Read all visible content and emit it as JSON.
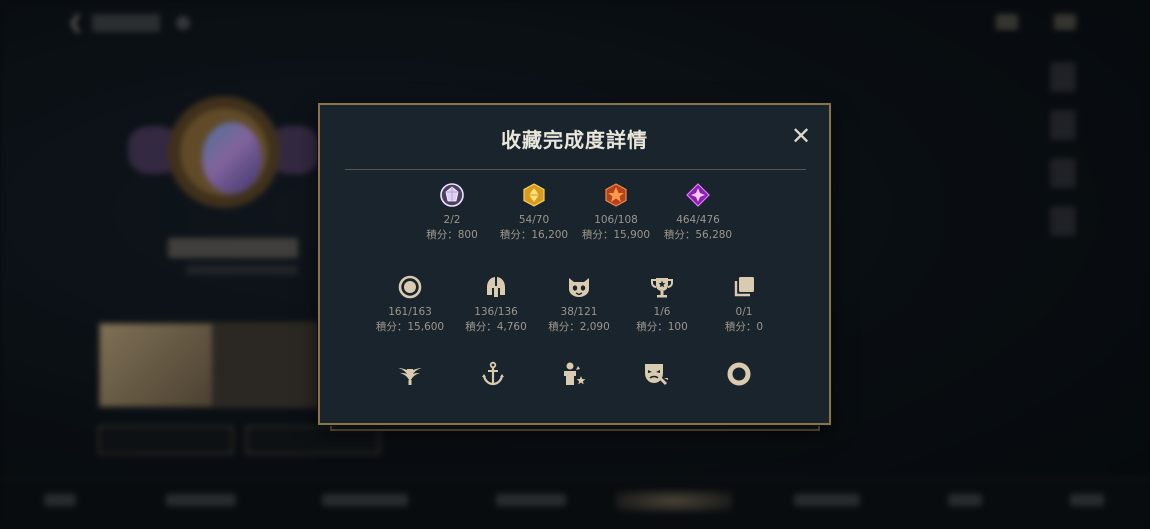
{
  "modal": {
    "title": "收藏完成度詳情",
    "close_label": "✕",
    "points_label": "積分："
  },
  "row1": [
    {
      "icon": "white-gem-icon",
      "count": "2/2",
      "points": "800",
      "color": "#d9c8f4"
    },
    {
      "icon": "gold-gem-icon",
      "count": "54/70",
      "points": "16,200",
      "color": "#e3b23a"
    },
    {
      "icon": "orange-gem-icon",
      "count": "106/108",
      "points": "15,900",
      "color": "#e46a2a"
    },
    {
      "icon": "purple-gem-icon",
      "count": "464/476",
      "points": "56,280",
      "color": "#b23ad6"
    }
  ],
  "row2": [
    {
      "icon": "ring-icon",
      "count": "161/163",
      "points": "15,600"
    },
    {
      "icon": "helmet-icon",
      "count": "136/136",
      "points": "4,760"
    },
    {
      "icon": "cat-face-icon",
      "count": "38/121",
      "points": "2,090"
    },
    {
      "icon": "trophy-icon",
      "count": "1/6",
      "points": "100"
    },
    {
      "icon": "cards-stack-icon",
      "count": "0/1",
      "points": "0"
    }
  ],
  "row3": [
    {
      "icon": "winged-emblem-icon"
    },
    {
      "icon": "anchor-icon"
    },
    {
      "icon": "hero-star-icon"
    },
    {
      "icon": "theater-mask-icon"
    },
    {
      "icon": "donut-ring-icon"
    }
  ],
  "colors": {
    "icon_tan": "#d9cbb0",
    "gold_border": "#8a7445",
    "panel_bg": "#1a242c"
  }
}
